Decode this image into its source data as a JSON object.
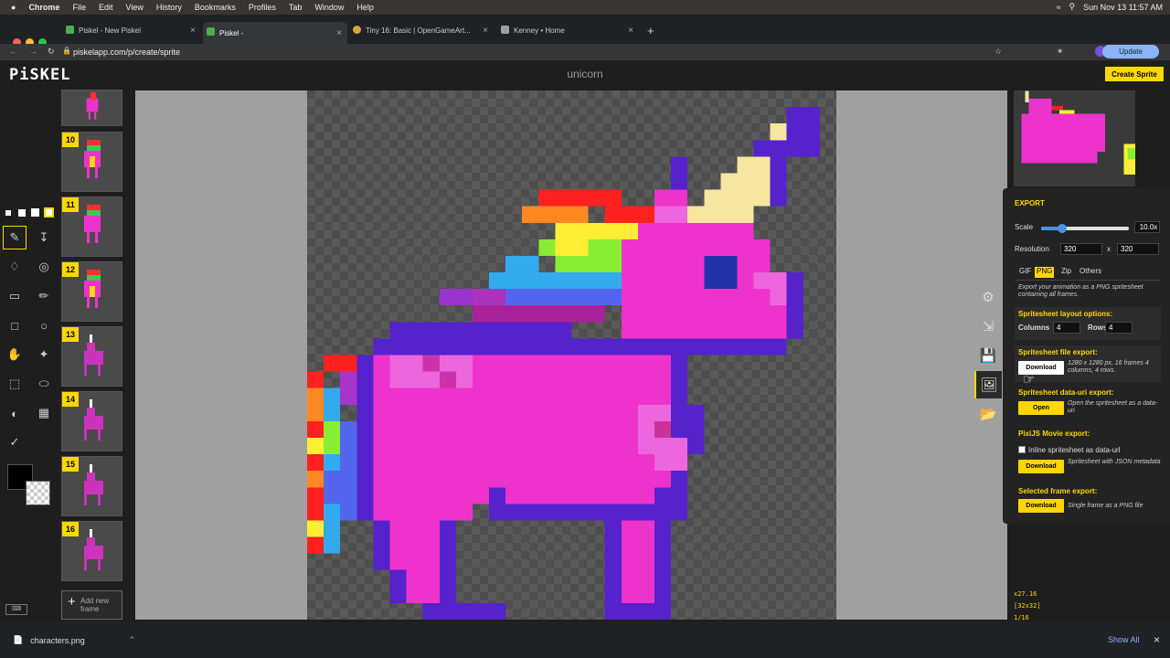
{
  "mac_menu": {
    "apple": "",
    "app": "Chrome",
    "items": [
      "File",
      "Edit",
      "View",
      "History",
      "Bookmarks",
      "Profiles",
      "Tab",
      "Window",
      "Help"
    ],
    "clock": "Sun Nov 13  11:57 AM"
  },
  "tabs": [
    {
      "title": "Piskel - New Piskel",
      "active": false,
      "fav": "#4caf50"
    },
    {
      "title": "Piskel -",
      "active": true,
      "fav": "#4caf50"
    },
    {
      "title": "Tiny 16: Basic | OpenGameArt...",
      "active": false,
      "fav": "#d9a441"
    },
    {
      "title": "Kenney • Home",
      "active": false,
      "fav": "#9aa0a6"
    }
  ],
  "address": {
    "url": "piskelapp.com/p/create/sprite",
    "update": "Update"
  },
  "header": {
    "logo": "PiSKEL",
    "sprite_name": "unicorn",
    "create_button": "Create Sprite"
  },
  "frames": [
    {
      "num": "10"
    },
    {
      "num": "11"
    },
    {
      "num": "12"
    },
    {
      "num": "13"
    },
    {
      "num": "14"
    },
    {
      "num": "15"
    },
    {
      "num": "16"
    }
  ],
  "add_frame": "Add new frame",
  "export": {
    "title": "EXPORT",
    "scale_label": "Scale",
    "scale_value": "10.0x",
    "scale_fraction": 0.24,
    "resolution_label": "Resolution",
    "res_w": "320",
    "res_x": "x",
    "res_h": "320",
    "tabs": [
      "GIF",
      "PNG",
      "Zip",
      "Others"
    ],
    "selected_tab": "PNG",
    "intro": "Export your animation as a PNG spritesheet containing all frames.",
    "layout_title": "Spritesheet layout options:",
    "columns_label": "Columns",
    "columns": "4",
    "rows_label": "Rows",
    "rows": "4",
    "file_title": "Spritesheet file export:",
    "download": "Download",
    "file_note": "1280 x 1280 px, 16 frames 4 columns, 4 rows.",
    "datauri_title": "Spritesheet data-uri export:",
    "open": "Open",
    "datauri_note": "Open the spritesheet as a data-uri",
    "pixi_title": "PixiJS Movie export:",
    "pixi_check": "Inline spritesheet as data-url",
    "pixi_note": "Spritesheet with JSON metadata",
    "frame_title": "Selected frame export:",
    "frame_note": "Single frame as a PNG file"
  },
  "status": {
    "coords": "x27.16",
    "size": "[32x32]",
    "frame": "1/16"
  },
  "download_bar": {
    "file": "characters.png",
    "show_all": "Show All"
  },
  "colors": {
    "accent": "#ffd700",
    "pink": "#ee33cc",
    "purple": "#5522cc",
    "outline": "#5a1fd0"
  }
}
